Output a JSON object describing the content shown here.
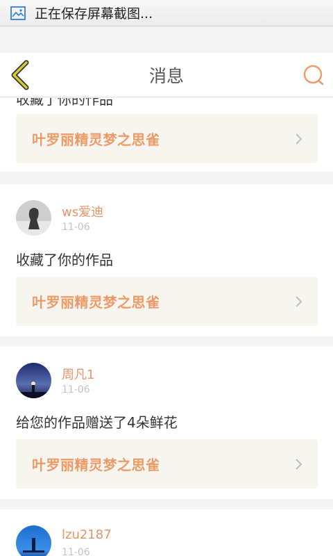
{
  "status_bar": {
    "icon": "image-icon",
    "text": "正在保存屏幕截图..."
  },
  "header": {
    "title": "消息",
    "back_icon": "chevron-left-icon",
    "search_icon": "search-icon"
  },
  "feed": {
    "items": [
      {
        "action": "收藏了你的作品",
        "work_title": "叶罗丽精灵梦之思雀"
      },
      {
        "user": "ws爱迪",
        "date": "11-06",
        "action": "收藏了你的作品",
        "work_title": "叶罗丽精灵梦之思雀"
      },
      {
        "user": "周凡1",
        "date": "11-06",
        "action": "给您的作品赠送了4朵鲜花",
        "work_title": "叶罗丽精灵梦之思雀"
      },
      {
        "user": "lzu2187",
        "date": "11-06"
      }
    ]
  },
  "colors": {
    "accent": "#ef9a66",
    "username": "#e89468",
    "back_icon": "#d8c83a",
    "card_box": "#f6f5ef"
  }
}
